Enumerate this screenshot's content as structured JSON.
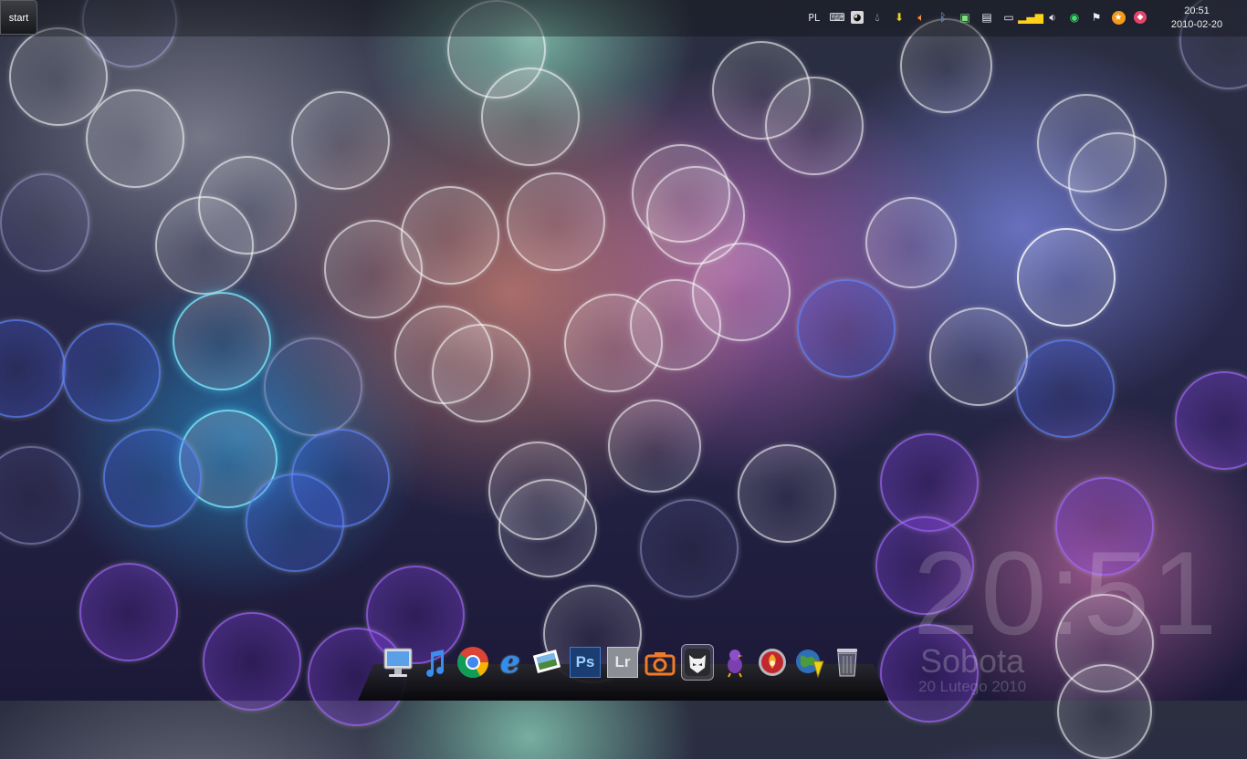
{
  "taskbar": {
    "start_label": "start",
    "language": "PL",
    "clock_time": "20:51",
    "clock_date": "2010-02-20",
    "tray_icons": [
      "keyboard-icon",
      "panda-icon",
      "droplet-icon",
      "download-arrow-icon",
      "speaker-muted-icon",
      "bluetooth-icon",
      "network-status-icon",
      "clipboard-icon",
      "monitor-icon",
      "signal-bars-icon",
      "volume-icon",
      "circle-status-icon",
      "action-center-flag-icon",
      "star-badge-icon",
      "alert-badge-icon"
    ]
  },
  "desktop_clock": {
    "time": "20:51",
    "day": "Sobota",
    "date": "20 Lutego 2010"
  },
  "dock": {
    "items": [
      "computer-icon",
      "itunes-icon",
      "chrome-icon",
      "internet-explorer-icon",
      "photo-viewer-icon",
      "photoshop-icon",
      "lightroom-icon",
      "camera-icon",
      "foobar-icon",
      "pidgin-icon",
      "firefox-alt-icon",
      "download-manager-icon",
      "recycle-bin-icon"
    ],
    "ps_label": "Ps",
    "lr_label": "Lr",
    "ie_label": "e"
  }
}
